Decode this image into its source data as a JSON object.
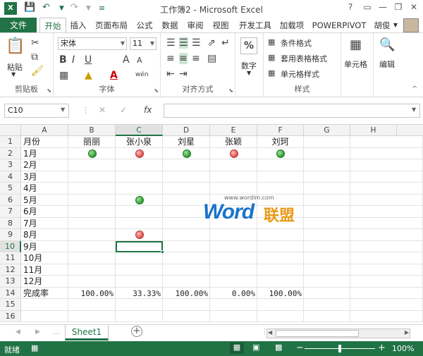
{
  "window": {
    "title": "工作簿2 - Microsoft Excel",
    "user": "胡俊",
    "controls": [
      "?",
      "▭",
      "—",
      "❐",
      "✕"
    ]
  },
  "qat": {
    "save": "save-icon",
    "undo": "undo-icon",
    "redo": "redo-icon",
    "customize": "customize-icon"
  },
  "tabs": [
    "文件",
    "开始",
    "插入",
    "页面布局",
    "公式",
    "数据",
    "审阅",
    "视图",
    "开发工具",
    "加载项",
    "POWERPIVOT"
  ],
  "active_tab": "开始",
  "ribbon": {
    "clipboard": {
      "paste": "粘贴",
      "label": "剪贴板"
    },
    "font": {
      "name": "宋体",
      "size": "11",
      "label": "字体",
      "bold": "B",
      "italic": "I",
      "underline": "U",
      "grow": "A",
      "shrink": "A",
      "fontcolor": "A",
      "phonetic": "wén"
    },
    "alignment": {
      "label": "对齐方式"
    },
    "number": {
      "label": "数字",
      "percent": "%"
    },
    "styles": {
      "conditional": "条件格式",
      "table": "套用表格格式",
      "cell": "单元格样式",
      "label": "样式"
    },
    "cells": {
      "label": "单元格"
    },
    "editing": {
      "label": "编辑"
    }
  },
  "formula_bar": {
    "name_box": "C10",
    "cancel": "✕",
    "enter": "✓",
    "fx": "fx",
    "content": ""
  },
  "sheet": {
    "columns": [
      "A",
      "B",
      "C",
      "D",
      "E",
      "F",
      "G",
      "H"
    ],
    "selected_column": "C",
    "selected_row": 10,
    "row_numbers": [
      "1",
      "2",
      "3",
      "4",
      "5",
      "6",
      "7",
      "8",
      "9",
      "10",
      "11",
      "12",
      "13",
      "14",
      "15",
      "16"
    ],
    "header_row": [
      "月份",
      "丽丽",
      "张小泉",
      "刘星",
      "张颖",
      "刘珂"
    ],
    "months": [
      "1月",
      "2月",
      "3月",
      "4月",
      "5月",
      "6月",
      "7月",
      "8月",
      "9月",
      "10月",
      "11月",
      "12月"
    ],
    "rate_label": "完成率",
    "rates": [
      "100.00%",
      "33.33%",
      "100.00%",
      "0.00%",
      "100.00%"
    ],
    "indicators": [
      {
        "row": 2,
        "col": "B",
        "color": "green"
      },
      {
        "row": 2,
        "col": "C",
        "color": "red"
      },
      {
        "row": 2,
        "col": "D",
        "color": "green"
      },
      {
        "row": 2,
        "col": "E",
        "color": "red"
      },
      {
        "row": 2,
        "col": "F",
        "color": "green"
      },
      {
        "row": 6,
        "col": "C",
        "color": "green"
      },
      {
        "row": 9,
        "col": "C",
        "color": "red"
      }
    ]
  },
  "watermark": {
    "url": "www.wordlm.com",
    "word": "Word",
    "cn": "联盟"
  },
  "sheet_tabs": [
    "Sheet1"
  ],
  "status": {
    "mode": "就绪",
    "zoom": "100%",
    "zoom_level": 1.0
  },
  "colors": {
    "accent": "#217346",
    "green_dot": "#2f9a2f",
    "red_dot": "#e04f4f"
  }
}
